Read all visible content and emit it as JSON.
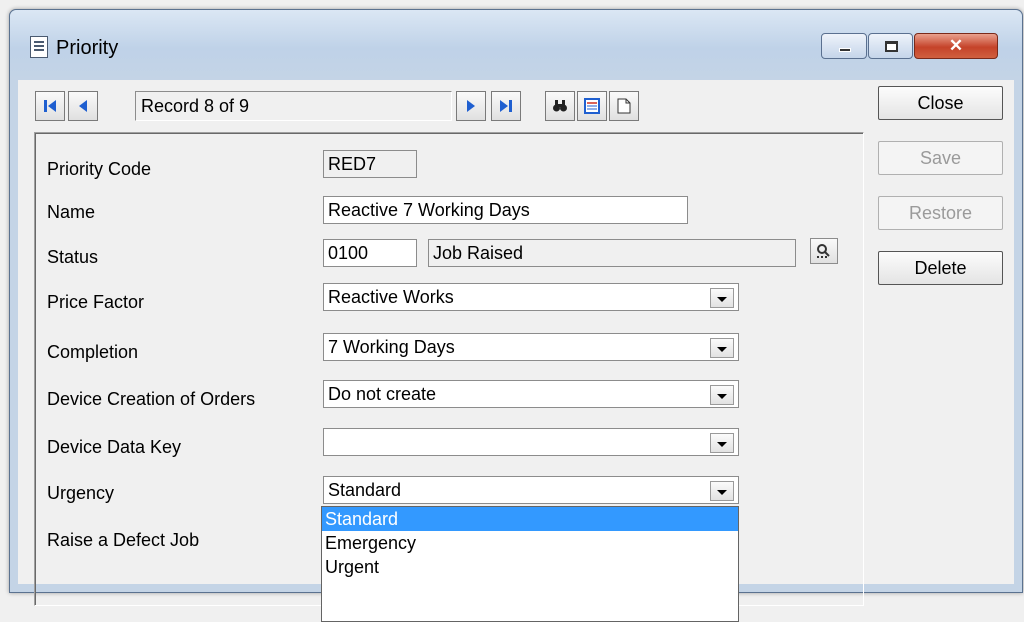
{
  "window": {
    "title": "Priority",
    "controls": {
      "minimize_icon": "minimize-icon",
      "maximize_icon": "maximize-icon",
      "close_icon": "close-icon"
    }
  },
  "navigator": {
    "record_text": "Record 8 of 9",
    "buttons": [
      "first-record-icon",
      "previous-record-icon",
      "next-record-icon",
      "last-record-icon",
      "find-icon",
      "list-view-icon",
      "new-record-icon"
    ]
  },
  "form": {
    "priority_code": {
      "label": "Priority Code",
      "value": "RED7"
    },
    "name": {
      "label": "Name",
      "value": "Reactive 7 Working Days"
    },
    "status": {
      "label": "Status",
      "code": "0100",
      "description": "Job Raised",
      "lookup_icon": "lookup-icon"
    },
    "price_factor": {
      "label": "Price Factor",
      "value": "Reactive Works"
    },
    "completion": {
      "label": "Completion",
      "value": "7 Working Days"
    },
    "device_creation": {
      "label": "Device Creation of Orders",
      "value": "Do not create"
    },
    "device_data_key": {
      "label": "Device Data Key",
      "value": ""
    },
    "urgency": {
      "label": "Urgency",
      "value": "Standard"
    },
    "raise_defect": {
      "label": "Raise a Defect Job"
    }
  },
  "urgency_dropdown": {
    "options": [
      "Standard",
      "Emergency",
      "Urgent"
    ],
    "selected": "Standard",
    "highlight_color": "#3399ff"
  },
  "actions": {
    "close": "Close",
    "save": "Save",
    "restore": "Restore",
    "delete": "Delete"
  }
}
